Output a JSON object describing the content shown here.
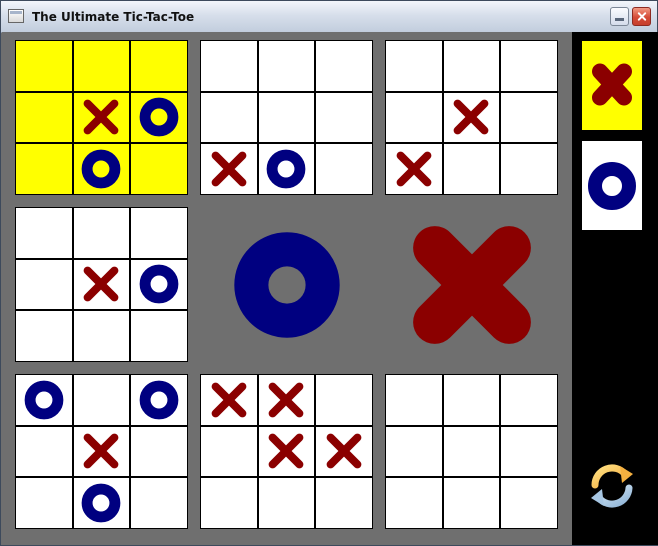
{
  "window": {
    "title": "The Ultimate Tic-Tac-Toe"
  },
  "colors": {
    "x": "#8b0000",
    "o": "#000080",
    "active_board": "#ffff00",
    "cell": "#ffffff",
    "background": "#6f6f6f",
    "sidebar": "#000000"
  },
  "boards": [
    {
      "position": "top-left",
      "highlighted": true,
      "winner": null,
      "cells": [
        "",
        "",
        "",
        "",
        "X",
        "O",
        "",
        "O",
        ""
      ]
    },
    {
      "position": "top-middle",
      "highlighted": false,
      "winner": null,
      "cells": [
        "",
        "",
        "",
        "",
        "",
        "",
        "X",
        "O",
        ""
      ]
    },
    {
      "position": "top-right",
      "highlighted": false,
      "winner": null,
      "cells": [
        "",
        "",
        "",
        "",
        "X",
        "",
        "X",
        "",
        ""
      ]
    },
    {
      "position": "middle-left",
      "highlighted": false,
      "winner": null,
      "cells": [
        "",
        "",
        "",
        "",
        "X",
        "O",
        "",
        "",
        ""
      ]
    },
    {
      "position": "center",
      "highlighted": false,
      "winner": "O",
      "cells": [
        "",
        "",
        "",
        "",
        "",
        "",
        "",
        "",
        ""
      ]
    },
    {
      "position": "middle-right",
      "highlighted": false,
      "winner": "X",
      "cells": [
        "",
        "",
        "",
        "",
        "",
        "",
        "",
        "",
        ""
      ]
    },
    {
      "position": "bottom-left",
      "highlighted": false,
      "winner": null,
      "cells": [
        "O",
        "",
        "O",
        "",
        "X",
        "",
        "",
        "O",
        ""
      ]
    },
    {
      "position": "bottom-middle",
      "highlighted": false,
      "winner": null,
      "cells": [
        "X",
        "X",
        "",
        "",
        "X",
        "X",
        "",
        "",
        ""
      ]
    },
    {
      "position": "bottom-right",
      "highlighted": false,
      "winner": null,
      "cells": [
        "",
        "",
        "",
        "",
        "",
        "",
        "",
        "",
        ""
      ]
    }
  ],
  "sidebar": {
    "players": [
      {
        "symbol": "X",
        "active": true
      },
      {
        "symbol": "O",
        "active": false
      }
    ],
    "restart_icon": "refresh-icon"
  }
}
